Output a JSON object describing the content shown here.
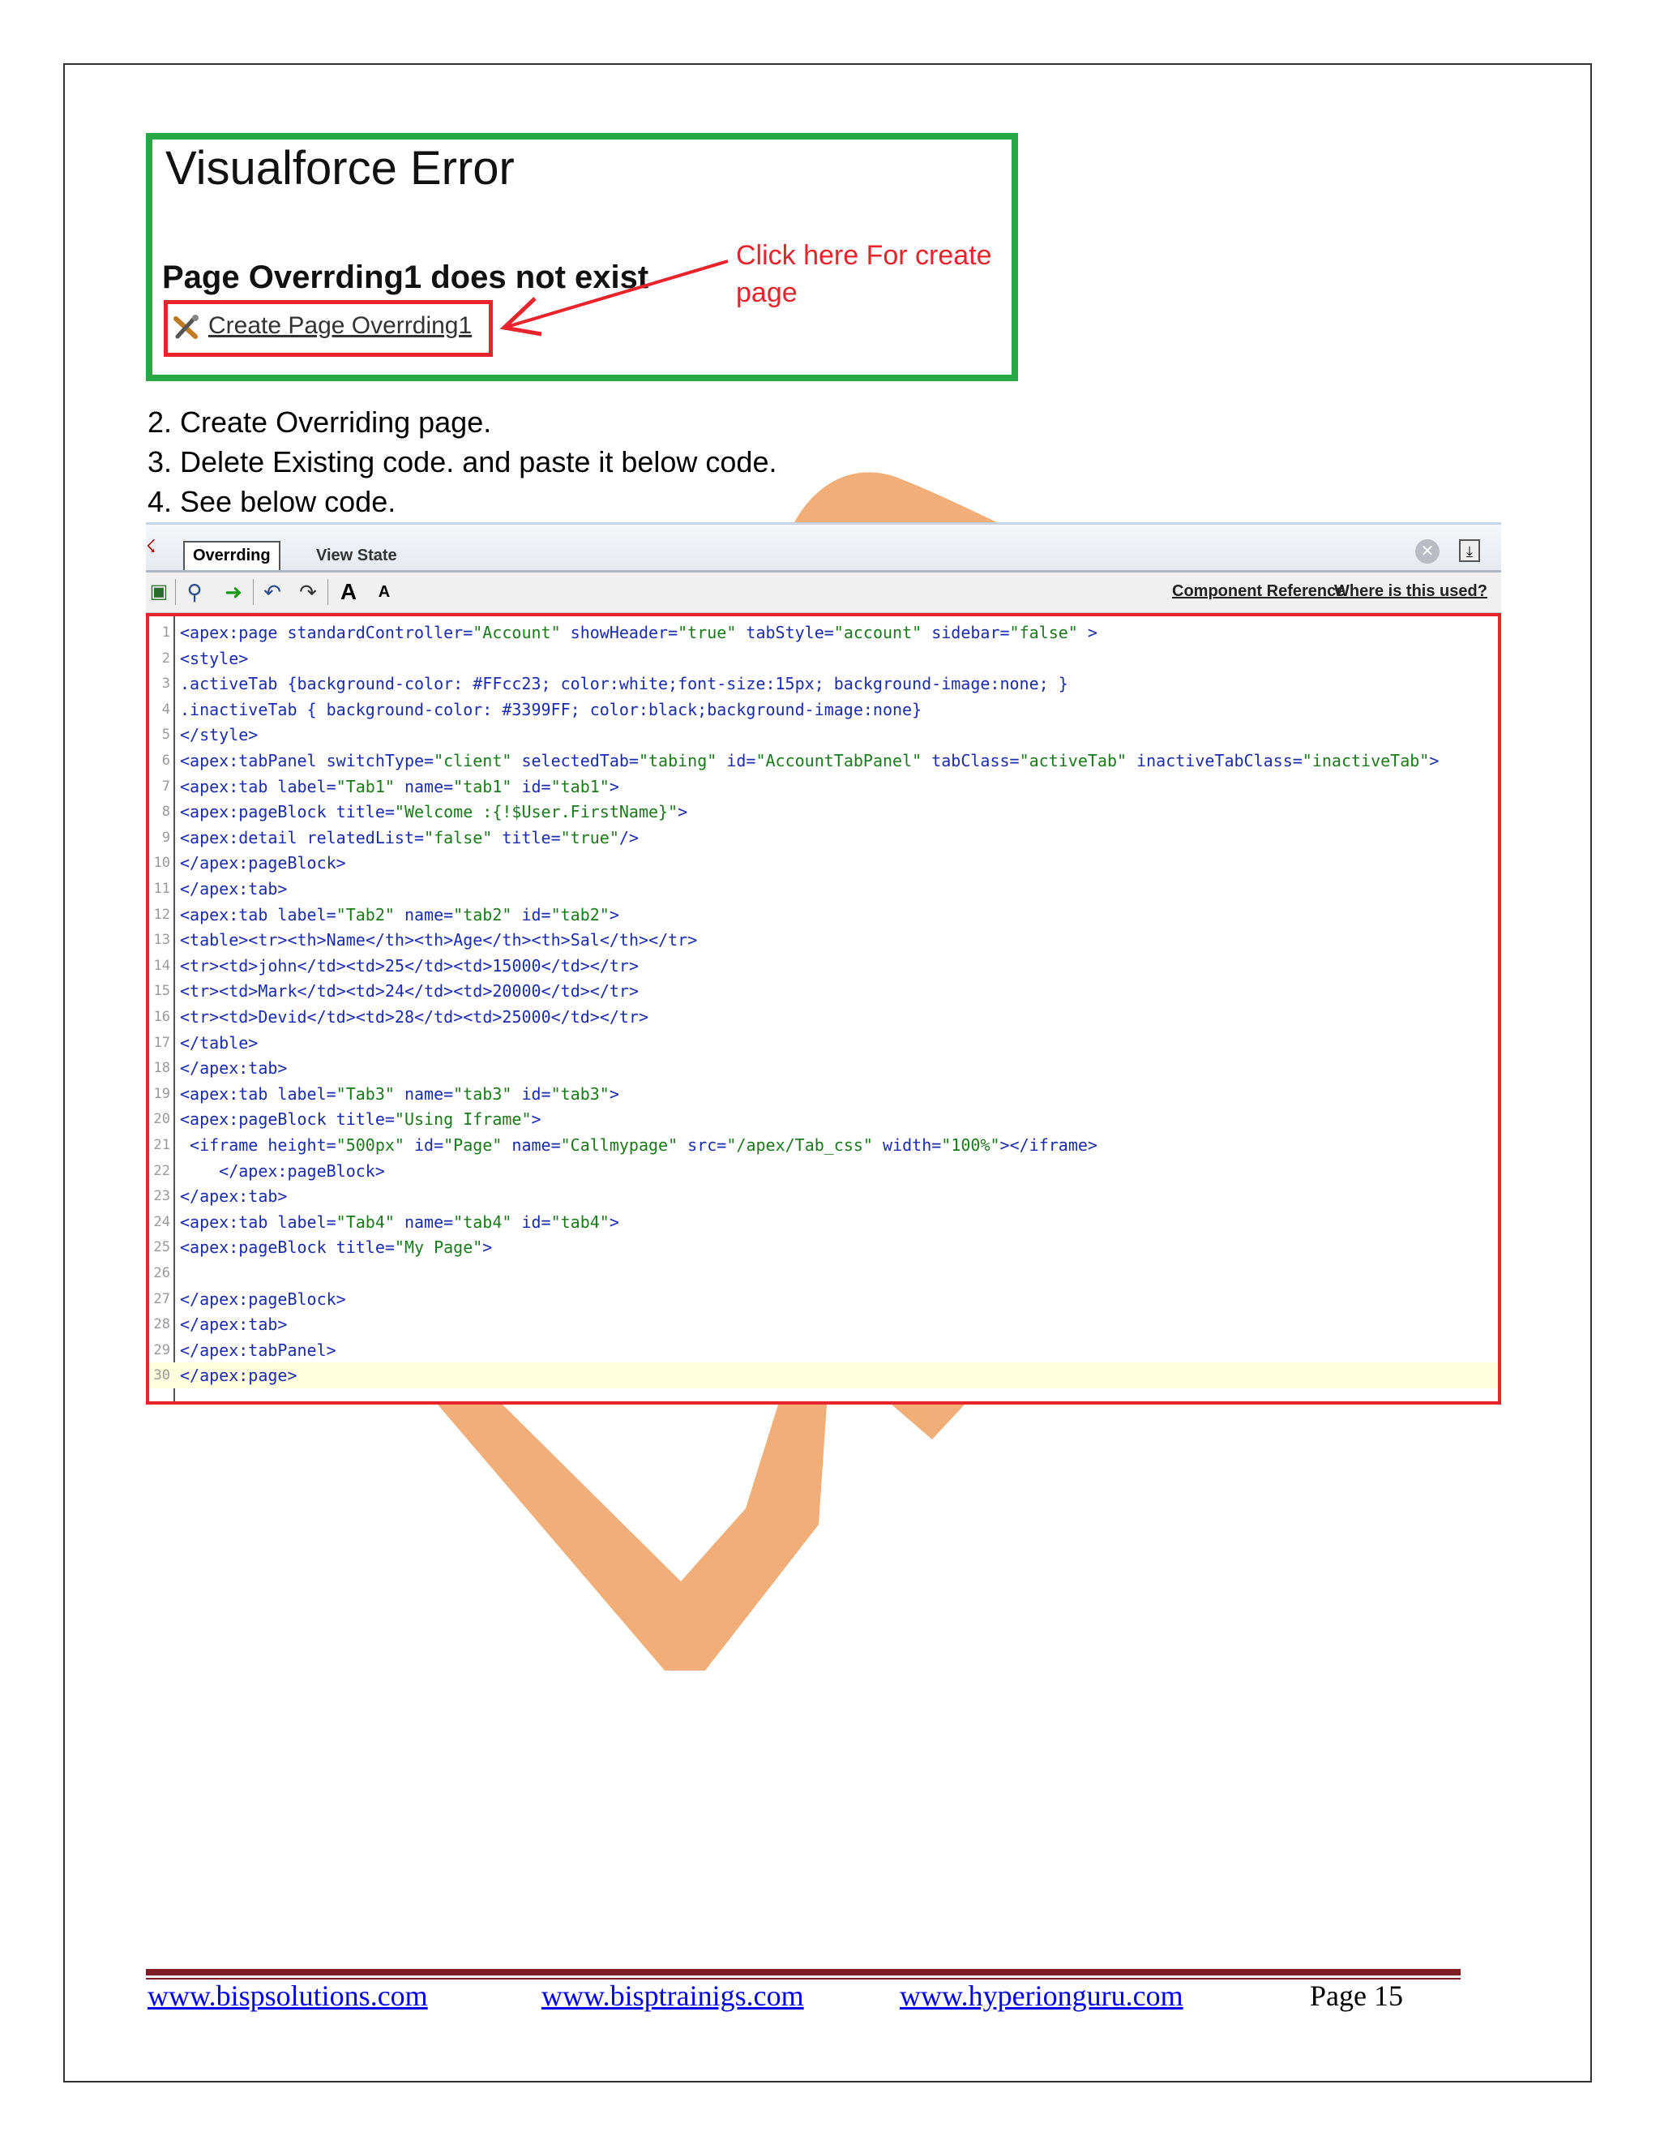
{
  "visualforce_error": {
    "title": "Visualforce Error",
    "message": "Page Overrding1 does not exist",
    "link_label": "Create Page Overrding1",
    "annotation": "Click here For create page",
    "box_color": "#27a844",
    "highlight_color": "#e8232b"
  },
  "steps": [
    "2. Create Overriding page.",
    "3. Delete Existing code.  and paste it below code.",
    "4. See below code."
  ],
  "editor": {
    "tabs": [
      "Overrding",
      "View State"
    ],
    "toolbar_links": [
      "Component Reference",
      "Where is this used?"
    ],
    "icons": [
      "save-icon",
      "search-icon",
      "go-arrow-icon",
      "undo-icon",
      "redo-icon",
      "font-increase-icon",
      "font-decrease-icon",
      "close-icon",
      "download-icon"
    ],
    "font_large": "A",
    "font_small": "A",
    "lines": [
      {
        "n": "1",
        "code": "<apex:page standardController=\"Account\" showHeader=\"true\" tabStyle=\"account\" sidebar=\"false\" >"
      },
      {
        "n": "2",
        "code": "<style>"
      },
      {
        "n": "3",
        "code": ".activeTab {background-color: #FFcc23; color:white;font-size:15px; background-image:none; }"
      },
      {
        "n": "4",
        "code": ".inactiveTab { background-color: #3399FF; color:black;background-image:none}"
      },
      {
        "n": "5",
        "code": "</style>"
      },
      {
        "n": "6",
        "code": "<apex:tabPanel switchType=\"client\" selectedTab=\"tabing\" id=\"AccountTabPanel\" tabClass=\"activeTab\" inactiveTabClass=\"inactiveTab\">"
      },
      {
        "n": "7",
        "code": "<apex:tab label=\"Tab1\" name=\"tab1\" id=\"tab1\">"
      },
      {
        "n": "8",
        "code": "<apex:pageBlock title=\"Welcome :{!$User.FirstName}\">"
      },
      {
        "n": "9",
        "code": "<apex:detail relatedList=\"false\" title=\"true\"/>"
      },
      {
        "n": "10",
        "code": "</apex:pageBlock>"
      },
      {
        "n": "11",
        "code": "</apex:tab>"
      },
      {
        "n": "12",
        "code": "<apex:tab label=\"Tab2\" name=\"tab2\" id=\"tab2\">"
      },
      {
        "n": "13",
        "code": "<table><tr><th>Name</th><th>Age</th><th>Sal</th></tr>"
      },
      {
        "n": "14",
        "code": "<tr><td>john</td><td>25</td><td>15000</td></tr>"
      },
      {
        "n": "15",
        "code": "<tr><td>Mark</td><td>24</td><td>20000</td></tr>"
      },
      {
        "n": "16",
        "code": "<tr><td>Devid</td><td>28</td><td>25000</td></tr>"
      },
      {
        "n": "17",
        "code": "</table>"
      },
      {
        "n": "18",
        "code": "</apex:tab>"
      },
      {
        "n": "19",
        "code": "<apex:tab label=\"Tab3\" name=\"tab3\" id=\"tab3\">"
      },
      {
        "n": "20",
        "code": "<apex:pageBlock title=\"Using Iframe\">"
      },
      {
        "n": "21",
        "code": " <iframe height=\"500px\" id=\"Page\" name=\"Callmypage\" src=\"/apex/Tab_css\" width=\"100%\"></iframe>"
      },
      {
        "n": "22",
        "code": "    </apex:pageBlock>"
      },
      {
        "n": "23",
        "code": "</apex:tab>"
      },
      {
        "n": "24",
        "code": "<apex:tab label=\"Tab4\" name=\"tab4\" id=\"tab4\">"
      },
      {
        "n": "25",
        "code": "<apex:pageBlock title=\"My Page\">"
      },
      {
        "n": "26",
        "code": ""
      },
      {
        "n": "27",
        "code": "</apex:pageBlock>"
      },
      {
        "n": "28",
        "code": "</apex:tab>"
      },
      {
        "n": "29",
        "code": "</apex:tabPanel>"
      },
      {
        "n": "30",
        "code": "</apex:page>"
      }
    ],
    "current_line": "30",
    "border_color": "#e8232b"
  },
  "footer": {
    "links": [
      "www.bispsolutions.com",
      "www.bisptrainigs.com",
      "www.hyperionguru.com"
    ],
    "page_label": "Page 15",
    "rule_color": "#7b1d22"
  },
  "watermark_color": "#f0a060"
}
